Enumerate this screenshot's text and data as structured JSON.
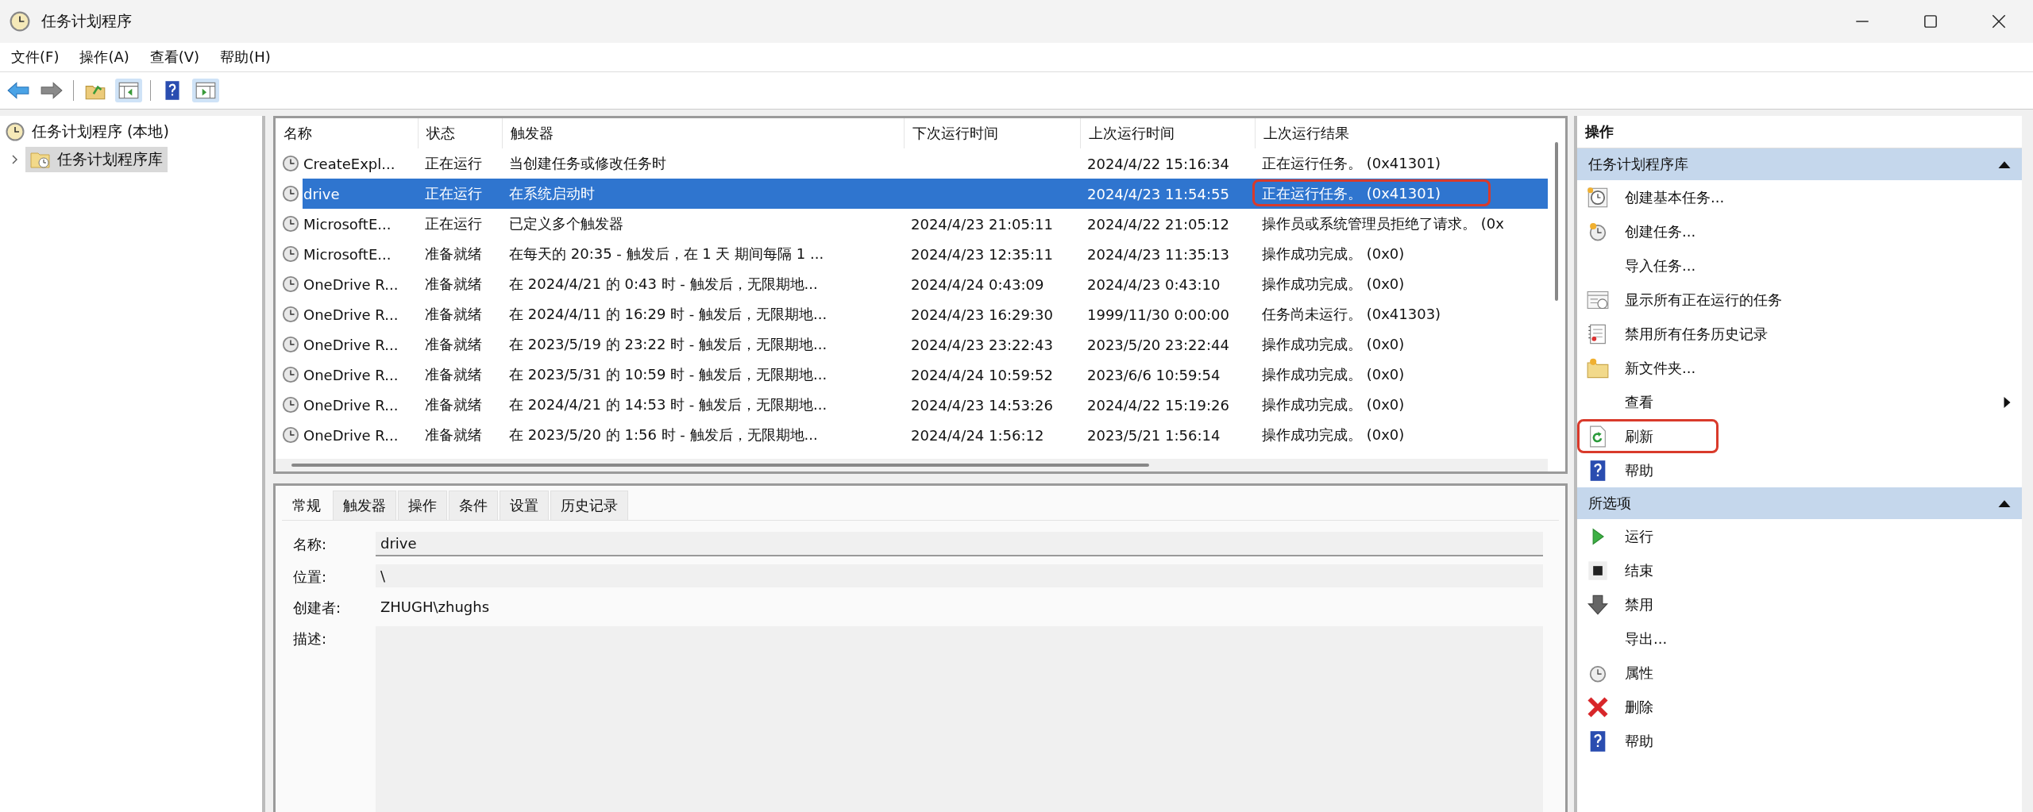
{
  "window": {
    "title": "任务计划程序"
  },
  "menu": [
    "文件(F)",
    "操作(A)",
    "查看(V)",
    "帮助(H)"
  ],
  "tree": {
    "label": "任务计划程序 (本地)",
    "children": [
      {
        "label": "任务计划程序库",
        "selected": true,
        "expanded": false
      }
    ]
  },
  "table": {
    "columns": [
      "名称",
      "状态",
      "触发器",
      "下次运行时间",
      "上次运行时间",
      "上次运行结果"
    ],
    "rows": [
      {
        "name": "CreateExpl...",
        "status": "正在运行",
        "trigger": "当创建任务或修改任务时",
        "next_run": "",
        "last_run": "2024/4/22 15:16:34",
        "result": "正在运行任务。 (0x41301)",
        "selected": false,
        "highlighted": false
      },
      {
        "name": "drive",
        "status": "正在运行",
        "trigger": "在系统启动时",
        "next_run": "",
        "last_run": "2024/4/23 11:54:55",
        "result": "正在运行任务。 (0x41301)",
        "selected": true,
        "highlighted": true
      },
      {
        "name": "MicrosoftE...",
        "status": "正在运行",
        "trigger": "已定义多个触发器",
        "next_run": "2024/4/23 21:05:11",
        "last_run": "2024/4/22 21:05:12",
        "result": "操作员或系统管理员拒绝了请求。 (0x",
        "selected": false,
        "highlighted": false
      },
      {
        "name": "MicrosoftE...",
        "status": "准备就绪",
        "trigger": "在每天的 20:35 - 触发后，在 1 天 期间每隔 1 ...",
        "next_run": "2024/4/23 12:35:11",
        "last_run": "2024/4/23 11:35:13",
        "result": "操作成功完成。 (0x0)",
        "selected": false,
        "highlighted": false
      },
      {
        "name": "OneDrive R...",
        "status": "准备就绪",
        "trigger": "在 2024/4/21 的 0:43 时 - 触发后，无限期地...",
        "next_run": "2024/4/24 0:43:09",
        "last_run": "2024/4/23 0:43:10",
        "result": "操作成功完成。 (0x0)",
        "selected": false,
        "highlighted": false
      },
      {
        "name": "OneDrive R...",
        "status": "准备就绪",
        "trigger": "在 2024/4/11 的 16:29 时 - 触发后，无限期地...",
        "next_run": "2024/4/23 16:29:30",
        "last_run": "1999/11/30 0:00:00",
        "result": "任务尚未运行。 (0x41303)",
        "selected": false,
        "highlighted": false
      },
      {
        "name": "OneDrive R...",
        "status": "准备就绪",
        "trigger": "在 2023/5/19 的 23:22 时 - 触发后，无限期地...",
        "next_run": "2024/4/23 23:22:43",
        "last_run": "2023/5/20 23:22:44",
        "result": "操作成功完成。 (0x0)",
        "selected": false,
        "highlighted": false
      },
      {
        "name": "OneDrive R...",
        "status": "准备就绪",
        "trigger": "在 2023/5/31 的 10:59 时 - 触发后，无限期地...",
        "next_run": "2024/4/24 10:59:52",
        "last_run": "2023/6/6 10:59:54",
        "result": "操作成功完成。 (0x0)",
        "selected": false,
        "highlighted": false
      },
      {
        "name": "OneDrive R...",
        "status": "准备就绪",
        "trigger": "在 2024/4/21 的 14:53 时 - 触发后，无限期地...",
        "next_run": "2024/4/23 14:53:26",
        "last_run": "2024/4/22 15:19:26",
        "result": "操作成功完成。 (0x0)",
        "selected": false,
        "highlighted": false
      },
      {
        "name": "OneDrive R...",
        "status": "准备就绪",
        "trigger": "在 2023/5/20 的 1:56 时 - 触发后，无限期地...",
        "next_run": "2024/4/24 1:56:12",
        "last_run": "2023/5/21 1:56:14",
        "result": "操作成功完成。 (0x0)",
        "selected": false,
        "highlighted": false
      }
    ]
  },
  "detail_tabs": [
    {
      "label": "常规",
      "selected": true
    },
    {
      "label": "触发器",
      "selected": false
    },
    {
      "label": "操作",
      "selected": false
    },
    {
      "label": "条件",
      "selected": false
    },
    {
      "label": "设置",
      "selected": false
    },
    {
      "label": "历史记录",
      "selected": false
    }
  ],
  "details": {
    "name_label": "名称:",
    "name_value": "drive",
    "location_label": "位置:",
    "location_value": "\\",
    "author_label": "创建者:",
    "author_value": "ZHUGH\\zhughs",
    "description_label": "描述:"
  },
  "actions": {
    "title": "操作",
    "sections": [
      {
        "title": "任务计划程序库",
        "expanded": true,
        "items": [
          {
            "label": "创建基本任务...",
            "kind": "wizard",
            "highlighted": false
          },
          {
            "label": "创建任务...",
            "kind": "task",
            "highlighted": false
          },
          {
            "label": "导入任务...",
            "kind": "plain",
            "highlighted": false
          },
          {
            "label": "显示所有正在运行的任务",
            "kind": "running",
            "highlighted": false
          },
          {
            "label": "禁用所有任务历史记录",
            "kind": "history",
            "highlighted": false
          },
          {
            "label": "新文件夹...",
            "kind": "folder",
            "highlighted": false
          },
          {
            "label": "查看",
            "kind": "submenu",
            "highlighted": false
          },
          {
            "label": "刷新",
            "kind": "refresh",
            "highlighted": true
          },
          {
            "label": "帮助",
            "kind": "help",
            "highlighted": false
          }
        ]
      },
      {
        "title": "所选项",
        "expanded": true,
        "items": [
          {
            "label": "运行",
            "kind": "run",
            "highlighted": false
          },
          {
            "label": "结束",
            "kind": "stop",
            "highlighted": false
          },
          {
            "label": "禁用",
            "kind": "disable",
            "highlighted": false
          },
          {
            "label": "导出...",
            "kind": "plain",
            "highlighted": false
          },
          {
            "label": "属性",
            "kind": "properties",
            "highlighted": false
          },
          {
            "label": "删除",
            "kind": "delete",
            "highlighted": false
          },
          {
            "label": "帮助",
            "kind": "help",
            "highlighted": false
          }
        ]
      }
    ]
  }
}
